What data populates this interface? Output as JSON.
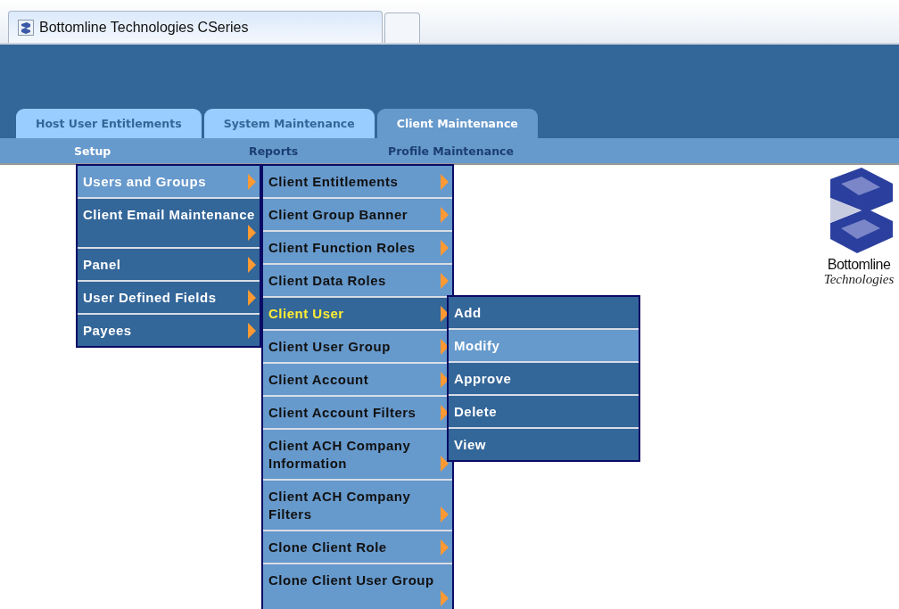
{
  "browser_tab": {
    "title": "Bottomline Technologies CSeries"
  },
  "tabs": [
    {
      "label": "Host User Entitlements",
      "selected": false
    },
    {
      "label": "System Maintenance",
      "selected": false
    },
    {
      "label": "Client Maintenance",
      "selected": true
    }
  ],
  "subnav": [
    {
      "label": "Setup",
      "selected": true
    },
    {
      "label": "Reports",
      "selected": false
    },
    {
      "label": "Profile Maintenance",
      "selected": false
    }
  ],
  "menus": [
    {
      "kind": "dark",
      "arrows": true,
      "items": [
        {
          "label": "Users and Groups",
          "selected": true
        },
        {
          "label": "Client Email Maintenance",
          "selected": false
        },
        {
          "label": "Panel",
          "selected": false
        },
        {
          "label": "User Defined Fields",
          "selected": false
        },
        {
          "label": "Payees",
          "selected": false
        }
      ]
    },
    {
      "kind": "light",
      "arrows": true,
      "items": [
        {
          "label": "Client Entitlements",
          "selected": false
        },
        {
          "label": "Client Group Banner",
          "selected": false
        },
        {
          "label": "Client Function Roles",
          "selected": false
        },
        {
          "label": "Client Data Roles",
          "selected": false
        },
        {
          "label": "Client User",
          "selected": true
        },
        {
          "label": "Client User Group",
          "selected": false
        },
        {
          "label": "Client Account",
          "selected": false
        },
        {
          "label": "Client Account Filters",
          "selected": false
        },
        {
          "label": "Client ACH Company Information",
          "selected": false
        },
        {
          "label": "Client ACH Company Filters",
          "selected": false
        },
        {
          "label": "Clone Client Role",
          "selected": false
        },
        {
          "label": "Clone Client User Group",
          "selected": false
        }
      ]
    },
    {
      "kind": "dark",
      "arrows": false,
      "items": [
        {
          "label": "Add",
          "selected": false
        },
        {
          "label": "Modify",
          "selected": true
        },
        {
          "label": "Approve",
          "selected": false
        },
        {
          "label": "Delete",
          "selected": false
        },
        {
          "label": "View",
          "selected": false
        }
      ]
    }
  ],
  "logo": {
    "name": "Bottomline",
    "tagline": "Technologies"
  }
}
